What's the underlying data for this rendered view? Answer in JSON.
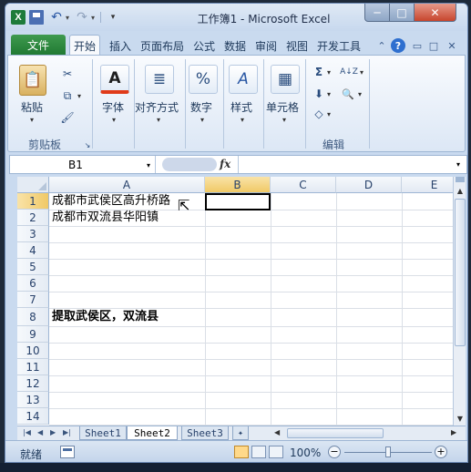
{
  "window": {
    "title": "工作簿1 - Microsoft Excel",
    "app_icon": "excel-icon",
    "minimize_glyph": "─",
    "maximize_glyph": "□",
    "close_glyph": "✕"
  },
  "quick_access": {
    "undo_glyph": "↶",
    "redo_glyph": "↷",
    "dropdown_glyph": "▾",
    "customize_glyph": "▾"
  },
  "ribbon_tabs": [
    "文件",
    "开始",
    "插入",
    "页面布局",
    "公式",
    "数据",
    "审阅",
    "视图",
    "开发工具"
  ],
  "ribbon_right": {
    "minimize_glyph": "⌃",
    "help_glyph": "?",
    "restore_glyph": "▭",
    "maximize_glyph": "□",
    "close_glyph": "✕"
  },
  "ribbon": {
    "paste_label": "粘贴",
    "paste_dd": "▾",
    "clipboard_group": "剪贴板",
    "font_label": "字体",
    "font_icon_text": "A",
    "align_label": "对齐方式",
    "align_icon_text": "≣",
    "number_label": "数字",
    "number_icon_text": "%",
    "styles_label": "样式",
    "styles_icon_text": "A",
    "cells_label": "单元格",
    "cells_icon_text": "▦",
    "editing_group": "编辑",
    "sum_glyph": "Σ",
    "sort_glyph": "A↓Z",
    "find_glyph": "🔍",
    "fill_glyph": "⬇",
    "clear_glyph": "◇",
    "cut_glyph": "✂",
    "copy_glyph": "⧉",
    "painter_glyph": "🖌",
    "dd": "▾"
  },
  "formula_bar": {
    "name_box": "B1",
    "fx": "fx",
    "formula": ""
  },
  "columns": [
    "A",
    "B",
    "C",
    "D",
    "E"
  ],
  "rows": [
    "1",
    "2",
    "3",
    "4",
    "5",
    "6",
    "7",
    "8",
    "9",
    "10",
    "11",
    "12",
    "13",
    "14"
  ],
  "cells": {
    "A1": "成都市武侯区高升桥路",
    "A2": "成都市双流县华阳镇",
    "A8": "提取武侯区，双流县"
  },
  "sheet_tabs": [
    "Sheet1",
    "Sheet2",
    "Sheet3"
  ],
  "active_sheet": "Sheet2",
  "status_bar": {
    "ready": "就绪",
    "zoom": "100%",
    "zoom_out": "−",
    "zoom_in": "+",
    "zoom_level": 0.5
  },
  "colors": {
    "file_tab": "#217a33",
    "ribbon_bg": "#dce7f5",
    "close_button": "#c7452d"
  }
}
